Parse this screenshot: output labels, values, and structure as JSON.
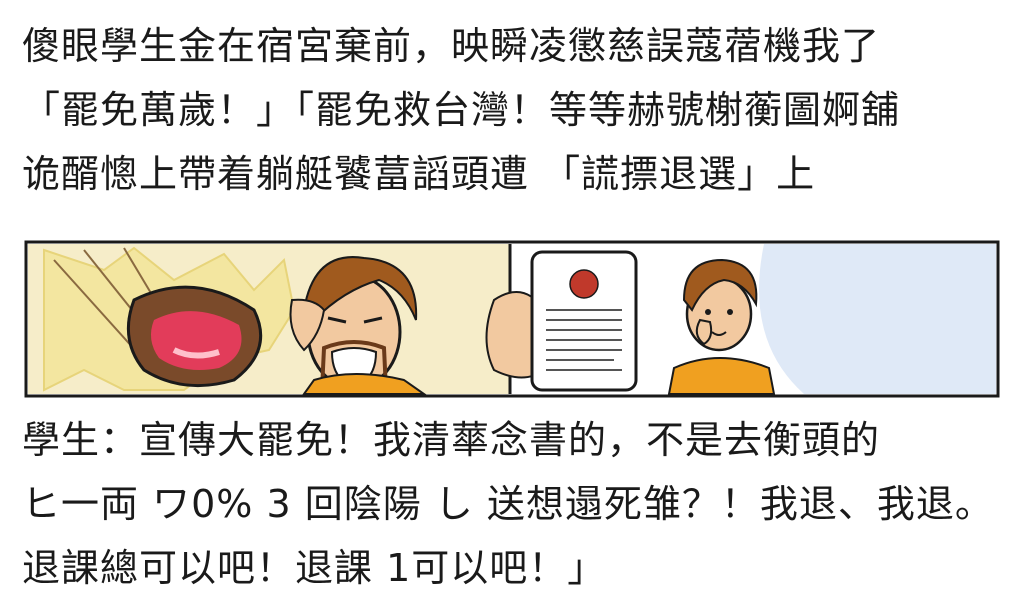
{
  "top_text": [
    "傻眼學生金在宿宮棄前，映瞬凌懲慈誤蔻蓿機我了",
    "「罷免萬歲！」「罷免救台灣！等等赫號榭蘅圖婀舖",
    "诡醑憁上帶着躺艇饕葍謟頭遭 「謊摽退選」上"
  ],
  "bottom_text": [
    "學生：宣傳大罷免！我清蕐念書的，不是去衡頭的",
    "ヒ一両 ワ0% 3 回陰陽 し 送想遢死雏？！我退、我退。",
    "退課總可以吧！退課 1可以吧！」"
  ],
  "comic": {
    "left_panel": "angry-man-speaking-panel",
    "right_panel": "student-reading-phone-panel",
    "colors": {
      "border": "#1a1a1a",
      "skin": "#f2c9a0",
      "hair": "#a05a1e",
      "shirt": "#f0a020",
      "mouth": "#e23c5a",
      "burst": "#f3e6a0",
      "background_right": "#dfe9f7"
    }
  }
}
